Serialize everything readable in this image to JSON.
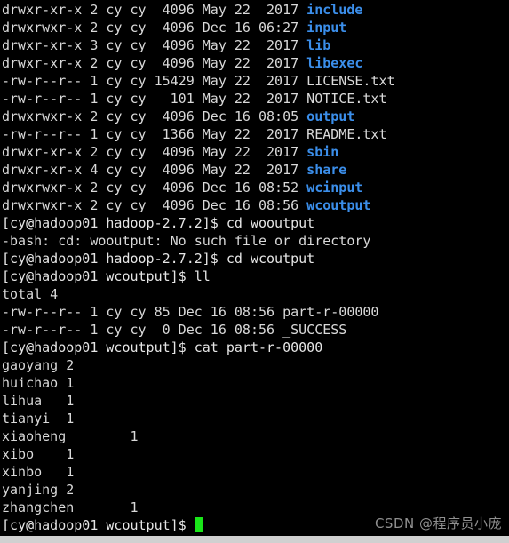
{
  "terminal": {
    "background_color": "#000000",
    "text_color": "#d9d9d9",
    "directory_color": "#3b8eea",
    "cursor_color": "#19e619",
    "watermark_color": "#9d9d9d",
    "watermark": "CSDN @程序员小庞",
    "lines": [
      {
        "id": "ls-include",
        "segments": [
          {
            "text": "drwxr-xr-x 2 cy cy  4096 May 22  2017 ",
            "style": "default"
          },
          {
            "text": "include",
            "style": "dir"
          }
        ]
      },
      {
        "id": "ls-input",
        "segments": [
          {
            "text": "drwxrwxr-x 2 cy cy  4096 Dec 16 06:27 ",
            "style": "default"
          },
          {
            "text": "input",
            "style": "dir"
          }
        ]
      },
      {
        "id": "ls-lib",
        "segments": [
          {
            "text": "drwxr-xr-x 3 cy cy  4096 May 22  2017 ",
            "style": "default"
          },
          {
            "text": "lib",
            "style": "dir"
          }
        ]
      },
      {
        "id": "ls-libexec",
        "segments": [
          {
            "text": "drwxr-xr-x 2 cy cy  4096 May 22  2017 ",
            "style": "default"
          },
          {
            "text": "libexec",
            "style": "dir"
          }
        ]
      },
      {
        "id": "ls-license",
        "segments": [
          {
            "text": "-rw-r--r-- 1 cy cy 15429 May 22  2017 LICENSE.txt",
            "style": "default"
          }
        ]
      },
      {
        "id": "ls-notice",
        "segments": [
          {
            "text": "-rw-r--r-- 1 cy cy   101 May 22  2017 NOTICE.txt",
            "style": "default"
          }
        ]
      },
      {
        "id": "ls-output",
        "segments": [
          {
            "text": "drwxrwxr-x 2 cy cy  4096 Dec 16 08:05 ",
            "style": "default"
          },
          {
            "text": "output",
            "style": "dir"
          }
        ]
      },
      {
        "id": "ls-readme",
        "segments": [
          {
            "text": "-rw-r--r-- 1 cy cy  1366 May 22  2017 README.txt",
            "style": "default"
          }
        ]
      },
      {
        "id": "ls-sbin",
        "segments": [
          {
            "text": "drwxr-xr-x 2 cy cy  4096 May 22  2017 ",
            "style": "default"
          },
          {
            "text": "sbin",
            "style": "dir"
          }
        ]
      },
      {
        "id": "ls-share",
        "segments": [
          {
            "text": "drwxr-xr-x 4 cy cy  4096 May 22  2017 ",
            "style": "default"
          },
          {
            "text": "share",
            "style": "dir"
          }
        ]
      },
      {
        "id": "ls-wcinput",
        "segments": [
          {
            "text": "drwxrwxr-x 2 cy cy  4096 Dec 16 08:52 ",
            "style": "default"
          },
          {
            "text": "wcinput",
            "style": "dir"
          }
        ]
      },
      {
        "id": "ls-wcoutput",
        "segments": [
          {
            "text": "drwxrwxr-x 2 cy cy  4096 Dec 16 08:56 ",
            "style": "default"
          },
          {
            "text": "wcoutput",
            "style": "dir"
          }
        ]
      },
      {
        "id": "cmd-cd-wooutput",
        "segments": [
          {
            "text": "[cy@hadoop01 hadoop-2.7.2]$ cd wooutput",
            "style": "prompt"
          }
        ]
      },
      {
        "id": "err-no-such-file",
        "segments": [
          {
            "text": "-bash: cd: wooutput: No such file or directory",
            "style": "default"
          }
        ]
      },
      {
        "id": "cmd-cd-wcoutput",
        "segments": [
          {
            "text": "[cy@hadoop01 hadoop-2.7.2]$ cd wcoutput",
            "style": "prompt"
          }
        ]
      },
      {
        "id": "cmd-ll",
        "segments": [
          {
            "text": "[cy@hadoop01 wcoutput]$ ll",
            "style": "prompt"
          }
        ]
      },
      {
        "id": "out-total",
        "segments": [
          {
            "text": "total 4",
            "style": "default"
          }
        ]
      },
      {
        "id": "ls-part-r-00000",
        "segments": [
          {
            "text": "-rw-r--r-- 1 cy cy 85 Dec 16 08:56 part-r-00000",
            "style": "default"
          }
        ]
      },
      {
        "id": "ls-success",
        "segments": [
          {
            "text": "-rw-r--r-- 1 cy cy  0 Dec 16 08:56 _SUCCESS",
            "style": "default"
          }
        ]
      },
      {
        "id": "cmd-cat-part",
        "segments": [
          {
            "text": "[cy@hadoop01 wcoutput]$ cat part-r-00000",
            "style": "prompt"
          }
        ]
      },
      {
        "id": "wc-gaoyang",
        "segments": [
          {
            "text": "gaoyang 2",
            "style": "default"
          }
        ]
      },
      {
        "id": "wc-huichao",
        "segments": [
          {
            "text": "huichao 1",
            "style": "default"
          }
        ]
      },
      {
        "id": "wc-lihua",
        "segments": [
          {
            "text": "lihua   1",
            "style": "default"
          }
        ]
      },
      {
        "id": "wc-tianyi",
        "segments": [
          {
            "text": "tianyi  1",
            "style": "default"
          }
        ]
      },
      {
        "id": "wc-xiaoheng",
        "segments": [
          {
            "text": "xiaoheng        1",
            "style": "default"
          }
        ]
      },
      {
        "id": "wc-xibo",
        "segments": [
          {
            "text": "xibo    1",
            "style": "default"
          }
        ]
      },
      {
        "id": "wc-xinbo",
        "segments": [
          {
            "text": "xinbo   1",
            "style": "default"
          }
        ]
      },
      {
        "id": "wc-yanjing",
        "segments": [
          {
            "text": "yanjing 2",
            "style": "default"
          }
        ]
      },
      {
        "id": "wc-zhangchen",
        "segments": [
          {
            "text": "zhangchen       1",
            "style": "default"
          }
        ]
      },
      {
        "id": "prompt-final",
        "segments": [
          {
            "text": "[cy@hadoop01 wcoutput]$ ",
            "style": "prompt"
          }
        ],
        "cursor": true
      }
    ],
    "word_counts": [
      {
        "word": "gaoyang",
        "count": 2
      },
      {
        "word": "huichao",
        "count": 1
      },
      {
        "word": "lihua",
        "count": 1
      },
      {
        "word": "tianyi",
        "count": 1
      },
      {
        "word": "xiaoheng",
        "count": 1
      },
      {
        "word": "xibo",
        "count": 1
      },
      {
        "word": "xinbo",
        "count": 1
      },
      {
        "word": "yanjing",
        "count": 2
      },
      {
        "word": "zhangchen",
        "count": 1
      }
    ]
  }
}
